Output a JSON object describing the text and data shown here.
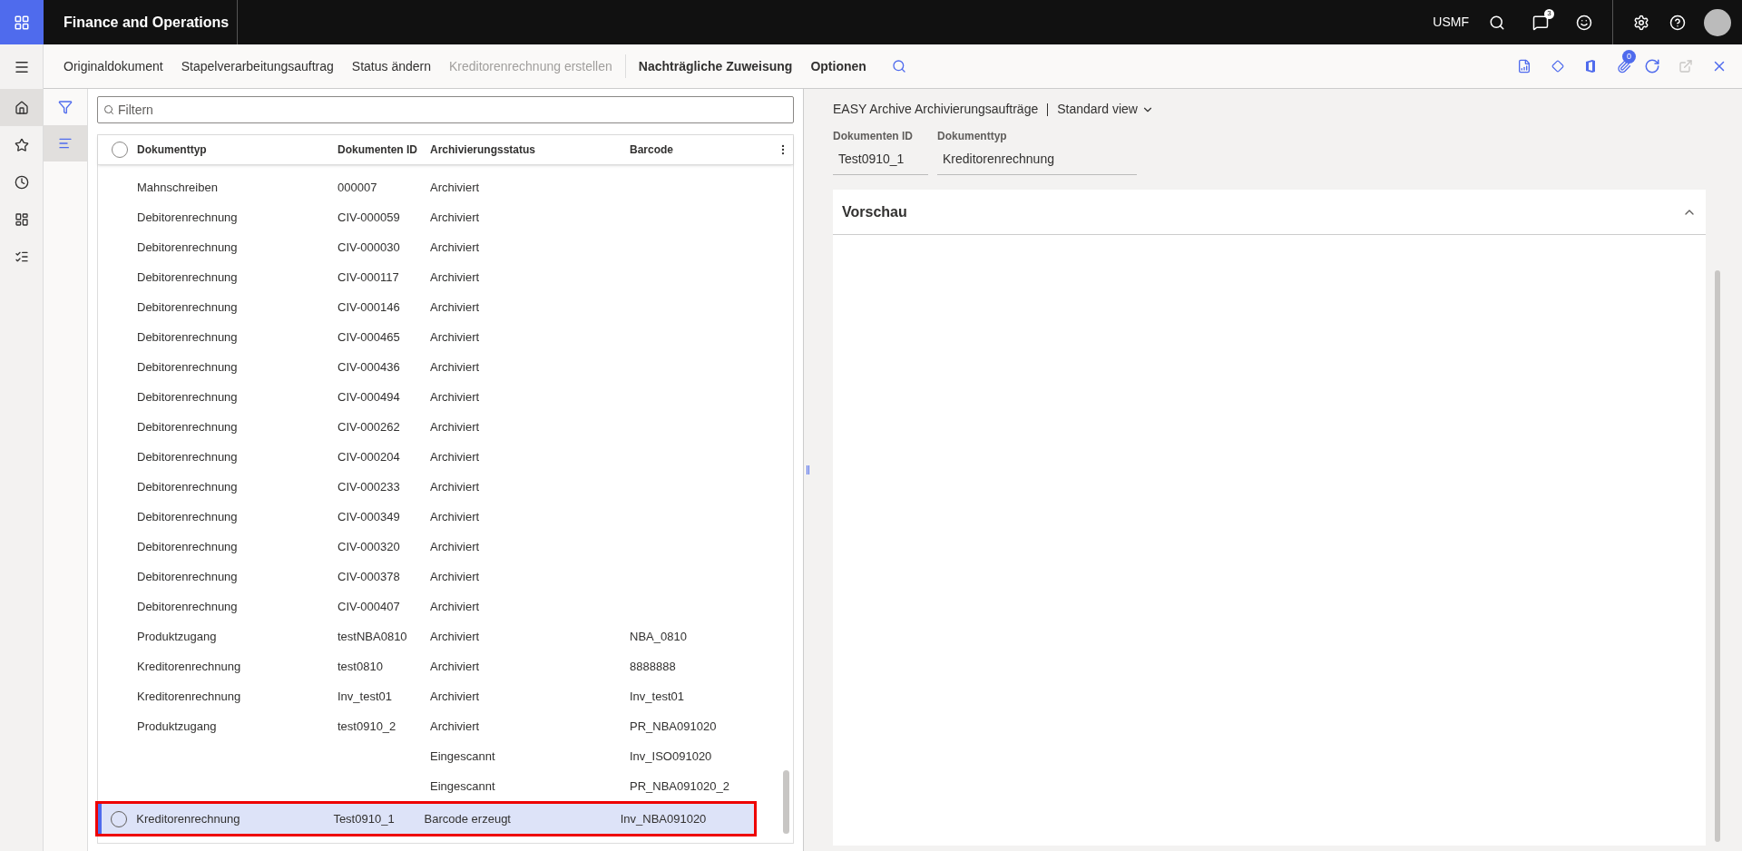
{
  "app_bar": {
    "title": "Finance and Operations",
    "company": "USMF",
    "notification_count": "3"
  },
  "action_bar": {
    "commands": [
      {
        "label": "Originaldokument",
        "disabled": false,
        "bold": false
      },
      {
        "label": "Stapelverarbeitungsauftrag",
        "disabled": false,
        "bold": false
      },
      {
        "label": "Status ändern",
        "disabled": false,
        "bold": false
      },
      {
        "label": "Kreditorenrechnung erstellen",
        "disabled": true,
        "bold": false
      },
      {
        "label": "Nachträgliche Zuweisung",
        "disabled": false,
        "bold": true
      },
      {
        "label": "Optionen",
        "disabled": false,
        "bold": true
      }
    ],
    "attachment_count": "0"
  },
  "list": {
    "filter": {
      "placeholder": "Filtern"
    },
    "select_all": {
      "checked": false
    },
    "columns": [
      "Dokumenttyp",
      "Dokumenten ID",
      "Archivierungsstatus",
      "Barcode"
    ],
    "rows": [
      {
        "cells": [
          "Mahnschreiben",
          "000007",
          "Archiviert",
          ""
        ],
        "selected": false
      },
      {
        "cells": [
          "Debitorenrechnung",
          "CIV-000059",
          "Archiviert",
          ""
        ],
        "selected": false
      },
      {
        "cells": [
          "Debitorenrechnung",
          "CIV-000030",
          "Archiviert",
          ""
        ],
        "selected": false
      },
      {
        "cells": [
          "Debitorenrechnung",
          "CIV-000117",
          "Archiviert",
          ""
        ],
        "selected": false
      },
      {
        "cells": [
          "Debitorenrechnung",
          "CIV-000146",
          "Archiviert",
          ""
        ],
        "selected": false
      },
      {
        "cells": [
          "Debitorenrechnung",
          "CIV-000465",
          "Archiviert",
          ""
        ],
        "selected": false
      },
      {
        "cells": [
          "Debitorenrechnung",
          "CIV-000436",
          "Archiviert",
          ""
        ],
        "selected": false
      },
      {
        "cells": [
          "Debitorenrechnung",
          "CIV-000494",
          "Archiviert",
          ""
        ],
        "selected": false
      },
      {
        "cells": [
          "Debitorenrechnung",
          "CIV-000262",
          "Archiviert",
          ""
        ],
        "selected": false
      },
      {
        "cells": [
          "Debitorenrechnung",
          "CIV-000204",
          "Archiviert",
          ""
        ],
        "selected": false
      },
      {
        "cells": [
          "Debitorenrechnung",
          "CIV-000233",
          "Archiviert",
          ""
        ],
        "selected": false
      },
      {
        "cells": [
          "Debitorenrechnung",
          "CIV-000349",
          "Archiviert",
          ""
        ],
        "selected": false
      },
      {
        "cells": [
          "Debitorenrechnung",
          "CIV-000320",
          "Archiviert",
          ""
        ],
        "selected": false
      },
      {
        "cells": [
          "Debitorenrechnung",
          "CIV-000378",
          "Archiviert",
          ""
        ],
        "selected": false
      },
      {
        "cells": [
          "Debitorenrechnung",
          "CIV-000407",
          "Archiviert",
          ""
        ],
        "selected": false
      },
      {
        "cells": [
          "Produktzugang",
          "testNBA0810",
          "Archiviert",
          "NBA_0810"
        ],
        "selected": false
      },
      {
        "cells": [
          "Kreditorenrechnung",
          "test0810",
          "Archiviert",
          "8888888"
        ],
        "selected": false
      },
      {
        "cells": [
          "Kreditorenrechnung",
          "Inv_test01",
          "Archiviert",
          "Inv_test01"
        ],
        "selected": false
      },
      {
        "cells": [
          "Produktzugang",
          "test0910_2",
          "Archiviert",
          "PR_NBA091020"
        ],
        "selected": false
      },
      {
        "cells": [
          "",
          "",
          "Eingescannt",
          "Inv_ISO091020"
        ],
        "selected": false
      },
      {
        "cells": [
          "",
          "",
          "Eingescannt",
          "PR_NBA091020_2"
        ],
        "selected": false
      },
      {
        "cells": [
          "Kreditorenrechnung",
          "Test0910_1",
          "Barcode erzeugt",
          "Inv_NBA091020"
        ],
        "selected": true,
        "outlined": true
      }
    ]
  },
  "details": {
    "title": "EASY Archive Archivierungsaufträge",
    "view": "Standard view",
    "fields": [
      {
        "label": "Dokumenten ID",
        "value": "Test0910_1"
      },
      {
        "label": "Dokumenttyp",
        "value": "Kreditorenrechnung"
      }
    ],
    "preview": {
      "title": "Vorschau",
      "expanded": true
    }
  }
}
